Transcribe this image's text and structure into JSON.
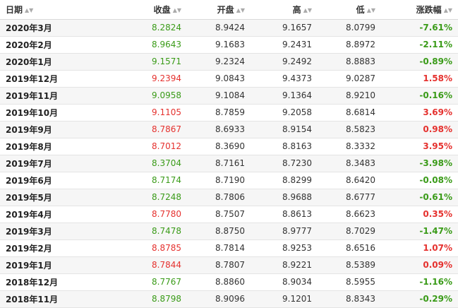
{
  "table": {
    "columns": [
      "日期",
      "收盘",
      "开盘",
      "高",
      "低",
      "涨跌幅"
    ],
    "sort_icon": "sort-arrows-icon",
    "colors": {
      "up": "#e5312e",
      "down": "#3a9b18"
    },
    "rows": [
      {
        "date": "2020年3月",
        "close": "8.2824",
        "open": "8.9424",
        "high": "9.1657",
        "low": "8.0799",
        "change": "-7.61%",
        "trend": "down"
      },
      {
        "date": "2020年2月",
        "close": "8.9643",
        "open": "9.1683",
        "high": "9.2431",
        "low": "8.8972",
        "change": "-2.11%",
        "trend": "down"
      },
      {
        "date": "2020年1月",
        "close": "9.1571",
        "open": "9.2324",
        "high": "9.2492",
        "low": "8.8883",
        "change": "-0.89%",
        "trend": "down"
      },
      {
        "date": "2019年12月",
        "close": "9.2394",
        "open": "9.0843",
        "high": "9.4373",
        "low": "9.0287",
        "change": "1.58%",
        "trend": "up"
      },
      {
        "date": "2019年11月",
        "close": "9.0958",
        "open": "9.1084",
        "high": "9.1364",
        "low": "8.9210",
        "change": "-0.16%",
        "trend": "down"
      },
      {
        "date": "2019年10月",
        "close": "9.1105",
        "open": "8.7859",
        "high": "9.2058",
        "low": "8.6814",
        "change": "3.69%",
        "trend": "up"
      },
      {
        "date": "2019年9月",
        "close": "8.7867",
        "open": "8.6933",
        "high": "8.9154",
        "low": "8.5823",
        "change": "0.98%",
        "trend": "up"
      },
      {
        "date": "2019年8月",
        "close": "8.7012",
        "open": "8.3690",
        "high": "8.8163",
        "low": "8.3332",
        "change": "3.95%",
        "trend": "up"
      },
      {
        "date": "2019年7月",
        "close": "8.3704",
        "open": "8.7161",
        "high": "8.7230",
        "low": "8.3483",
        "change": "-3.98%",
        "trend": "down"
      },
      {
        "date": "2019年6月",
        "close": "8.7174",
        "open": "8.7190",
        "high": "8.8299",
        "low": "8.6420",
        "change": "-0.08%",
        "trend": "down"
      },
      {
        "date": "2019年5月",
        "close": "8.7248",
        "open": "8.7806",
        "high": "8.9688",
        "low": "8.6777",
        "change": "-0.61%",
        "trend": "down"
      },
      {
        "date": "2019年4月",
        "close": "8.7780",
        "open": "8.7507",
        "high": "8.8613",
        "low": "8.6623",
        "change": "0.35%",
        "trend": "up"
      },
      {
        "date": "2019年3月",
        "close": "8.7478",
        "open": "8.8750",
        "high": "8.9777",
        "low": "8.7029",
        "change": "-1.47%",
        "trend": "down"
      },
      {
        "date": "2019年2月",
        "close": "8.8785",
        "open": "8.7814",
        "high": "8.9253",
        "low": "8.6516",
        "change": "1.07%",
        "trend": "up"
      },
      {
        "date": "2019年1月",
        "close": "8.7844",
        "open": "8.7807",
        "high": "8.9221",
        "low": "8.5389",
        "change": "0.09%",
        "trend": "up"
      },
      {
        "date": "2018年12月",
        "close": "8.7767",
        "open": "8.8860",
        "high": "8.9034",
        "low": "8.5955",
        "change": "-1.16%",
        "trend": "down"
      },
      {
        "date": "2018年11月",
        "close": "8.8798",
        "open": "8.9096",
        "high": "9.1201",
        "low": "8.8343",
        "change": "-0.29%",
        "trend": "down"
      }
    ]
  }
}
